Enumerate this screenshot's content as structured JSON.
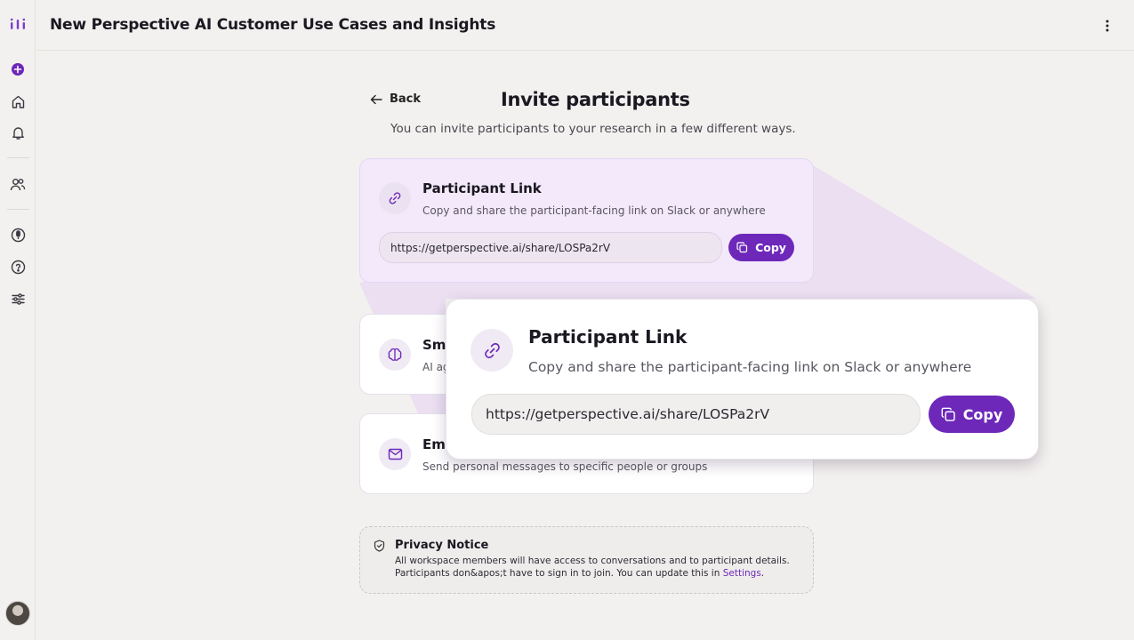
{
  "app": {
    "title": "New Perspective AI Customer Use Cases and Insights"
  },
  "sidebar": {
    "items": [
      {
        "icon": "logo-icon"
      },
      {
        "icon": "new-research-icon"
      },
      {
        "icon": "home-icon"
      },
      {
        "icon": "bell-icon"
      },
      {
        "icon": "people-icon"
      },
      {
        "icon": "microphone-icon"
      },
      {
        "icon": "help-icon"
      },
      {
        "icon": "sliders-icon"
      }
    ]
  },
  "nav": {
    "back_label": "Back"
  },
  "page": {
    "title": "Invite participants",
    "subtitle": "You can invite participants to your research in a few different ways."
  },
  "cards": {
    "participant_link": {
      "title": "Participant Link",
      "description": "Copy and share the participant-facing link on Slack or anywhere",
      "url": "https://getperspective.ai/share/LOSPa2rV",
      "copy_label": "Copy"
    },
    "smart": {
      "title_partial": "Sm",
      "desc_partial": "AI ag"
    },
    "email": {
      "title_partial": "Ema",
      "description": "Send personal messages to specific people or groups"
    }
  },
  "zoom": {
    "title": "Participant Link",
    "description": "Copy and share the participant-facing link on Slack or anywhere",
    "url": "https://getperspective.ai/share/LOSPa2rV",
    "copy_label": "Copy"
  },
  "privacy": {
    "title": "Privacy Notice",
    "line1": "All workspace members will have access to conversations and to participant details.",
    "line2_prefix": "Participants don&apos;t have to sign in to join. You can update this in ",
    "link": "Settings",
    "line2_suffix": "."
  },
  "colors": {
    "accent": "#6d28b9",
    "highlight_bg": "#f3e9fb",
    "page_bg": "#f3f1ef"
  }
}
